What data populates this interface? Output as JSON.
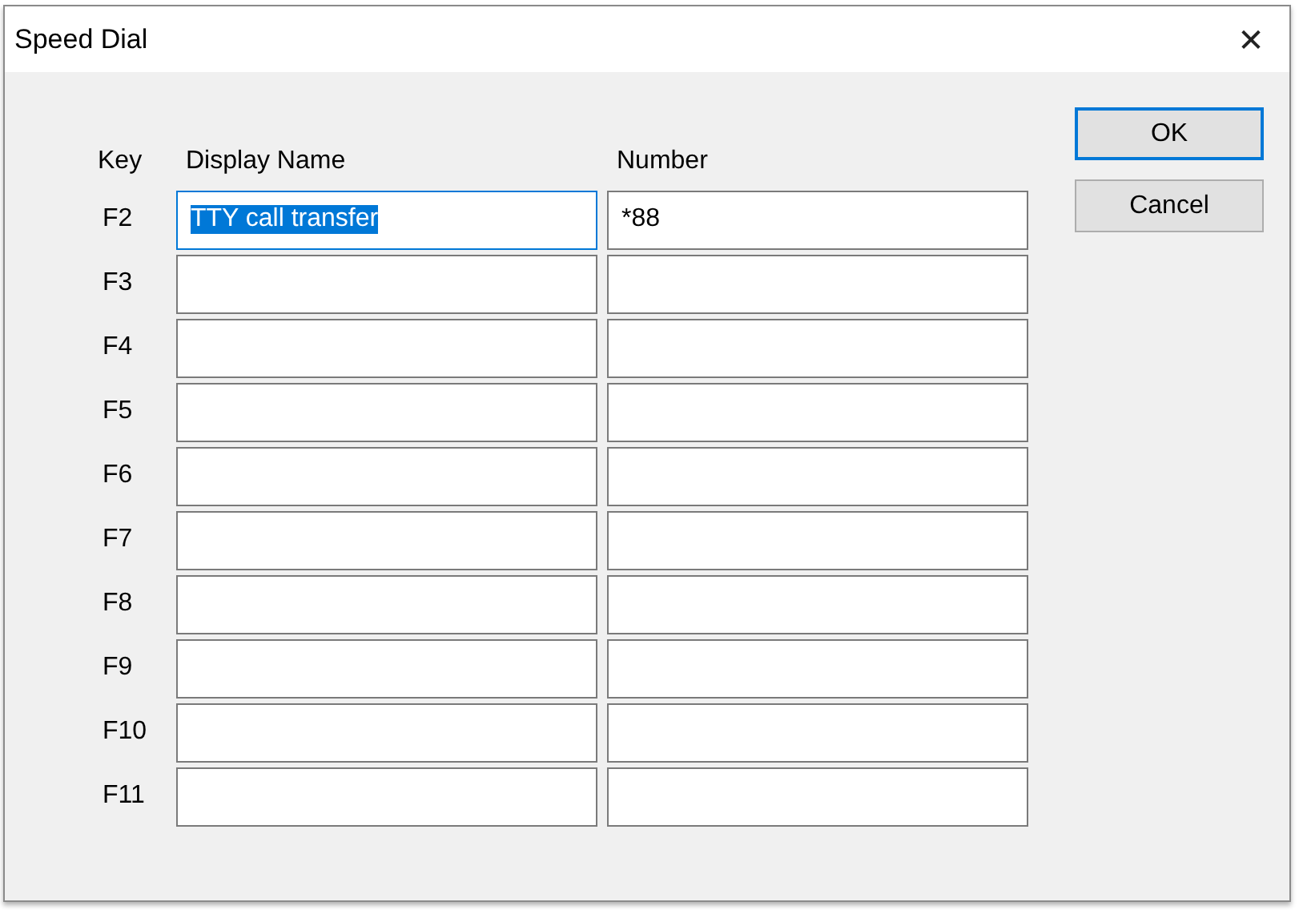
{
  "window": {
    "title": "Speed Dial",
    "close": "✕"
  },
  "columns": {
    "key": "Key",
    "display_name": "Display Name",
    "number": "Number"
  },
  "rows": [
    {
      "key": "F2",
      "display_name": "TTY call transfer",
      "number": "*88",
      "focused": true
    },
    {
      "key": "F3",
      "focused": false
    },
    {
      "key": "F4",
      "focused": false
    },
    {
      "key": "F5",
      "focused": false
    },
    {
      "key": "F6",
      "focused": false
    },
    {
      "key": "F7",
      "focused": false
    },
    {
      "key": "F8",
      "focused": false
    },
    {
      "key": "F9",
      "focused": false
    },
    {
      "key": "F10",
      "focused": false
    },
    {
      "key": "F11",
      "focused": false
    }
  ],
  "buttons": [
    {
      "label": "OK",
      "default": true
    },
    {
      "label": "Cancel",
      "default": false
    }
  ]
}
